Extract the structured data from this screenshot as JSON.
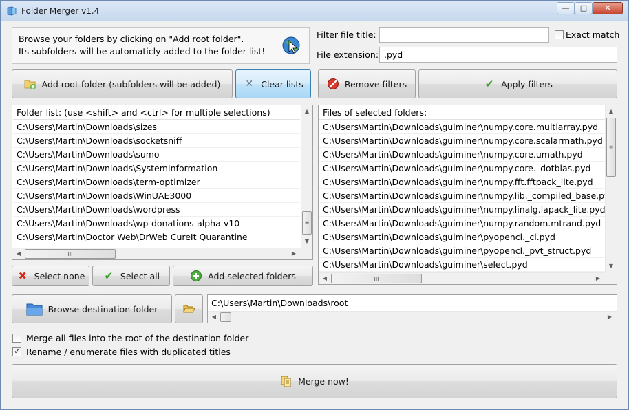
{
  "window": {
    "title": "Folder Merger v1.4",
    "min_glyph": "—",
    "max_glyph": "□",
    "close_glyph": "✕"
  },
  "info": {
    "line1": "Browse your folders by clicking on \"Add root folder\".",
    "line2": "Its subfolders will be automaticly added to the folder list!"
  },
  "filters": {
    "title_label": "Filter file title:",
    "title_value": "",
    "exact_match_label": "Exact match",
    "exact_match_checked": false,
    "ext_label": "File extension:",
    "ext_value": ".pyd"
  },
  "buttons": {
    "add_root": "Add root folder (subfolders will be added)",
    "clear_lists": "Clear lists",
    "remove_filters": "Remove filters",
    "apply_filters": "Apply filters",
    "select_none": "Select none",
    "select_all": "Select all",
    "add_selected": "Add selected folders",
    "browse_dest": "Browse destination folder",
    "merge": "Merge now!"
  },
  "folder_list": {
    "header": "Folder list: (use <shift> and <ctrl> for multiple selections)",
    "items": [
      "C:\\Users\\Martin\\Downloads\\sizes",
      "C:\\Users\\Martin\\Downloads\\socketsniff",
      "C:\\Users\\Martin\\Downloads\\sumo",
      "C:\\Users\\Martin\\Downloads\\SystemInformation",
      "C:\\Users\\Martin\\Downloads\\term-optimizer",
      "C:\\Users\\Martin\\Downloads\\WinUAE3000",
      "C:\\Users\\Martin\\Downloads\\wordpress",
      "C:\\Users\\Martin\\Downloads\\wp-donations-alpha-v10",
      "C:\\Users\\Martin\\Doctor Web\\DrWeb CureIt Quarantine"
    ]
  },
  "file_list": {
    "header": "Files of selected folders:",
    "items": [
      "C:\\Users\\Martin\\Downloads\\guiminer\\numpy.core.multiarray.pyd",
      "C:\\Users\\Martin\\Downloads\\guiminer\\numpy.core.scalarmath.pyd",
      "C:\\Users\\Martin\\Downloads\\guiminer\\numpy.core.umath.pyd",
      "C:\\Users\\Martin\\Downloads\\guiminer\\numpy.core._dotblas.pyd",
      "C:\\Users\\Martin\\Downloads\\guiminer\\numpy.fft.fftpack_lite.pyd",
      "C:\\Users\\Martin\\Downloads\\guiminer\\numpy.lib._compiled_base.pyd",
      "C:\\Users\\Martin\\Downloads\\guiminer\\numpy.linalg.lapack_lite.pyd",
      "C:\\Users\\Martin\\Downloads\\guiminer\\numpy.random.mtrand.pyd",
      "C:\\Users\\Martin\\Downloads\\guiminer\\pyopencl._cl.pyd",
      "C:\\Users\\Martin\\Downloads\\guiminer\\pyopencl._pvt_struct.pyd",
      "C:\\Users\\Martin\\Downloads\\guiminer\\select.pyd"
    ]
  },
  "destination": {
    "path": "C:\\Users\\Martin\\Downloads\\root"
  },
  "options": {
    "merge_root_label": "Merge all files into the root of the destination folder",
    "merge_root_checked": false,
    "rename_label": "Rename / enumerate files with duplicated titles",
    "rename_checked": true
  },
  "glyphs": {
    "up": "▲",
    "down": "▼",
    "left": "◀",
    "right": "▶",
    "grip_h": "III",
    "grip_v": "≡"
  },
  "icons": {
    "app": "folder-merge-icon",
    "globe": "globe-cursor-icon",
    "add_folder": "folder-add-icon",
    "clear": "x-icon",
    "remove": "no-entry-icon",
    "apply": "check-icon",
    "select_none": "red-x-icon",
    "select_all": "green-check-icon",
    "add_selected": "green-plus-icon",
    "browse": "blue-folder-icon",
    "open": "folder-open-icon",
    "merge": "merge-files-icon"
  }
}
